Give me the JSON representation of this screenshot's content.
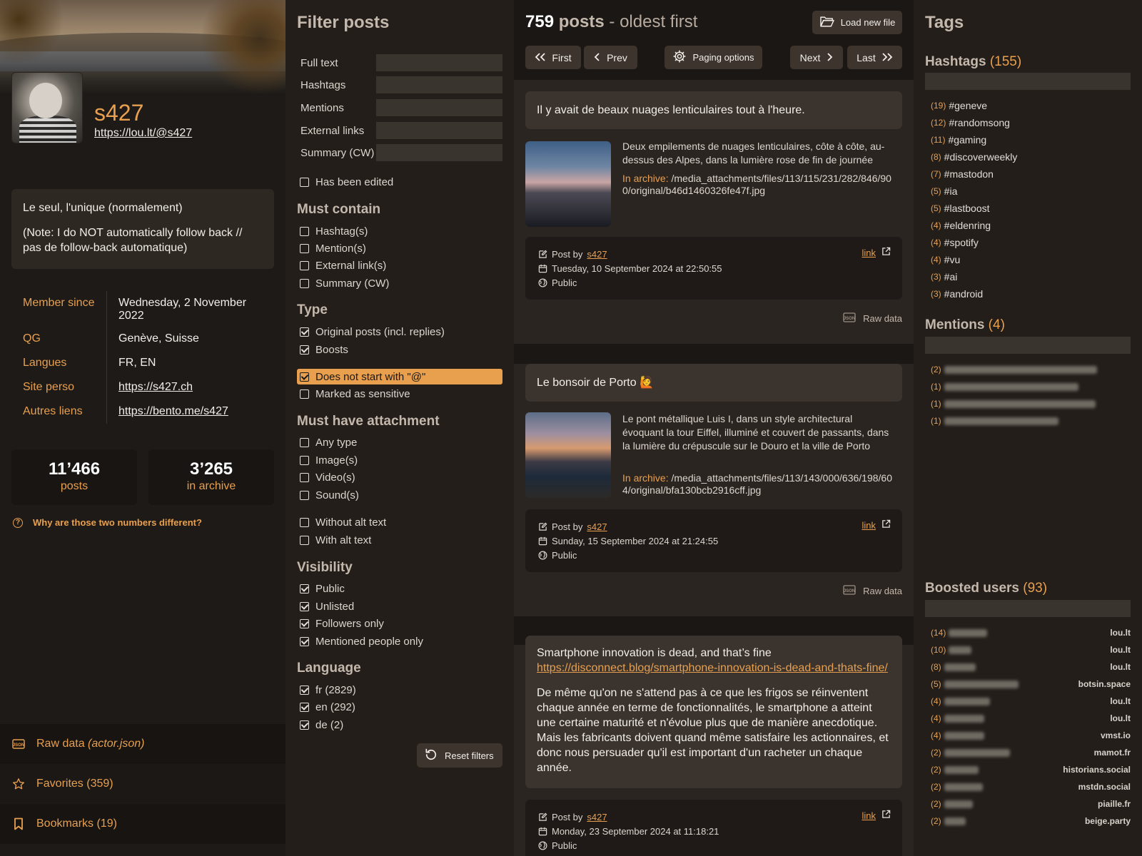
{
  "profile": {
    "username": "s427",
    "profile_url": "https://lou.lt/@s427",
    "bio": [
      "Le seul, l'unique (normalement)",
      "(Note: I do NOT automatically follow back // pas de follow-back automatique)"
    ],
    "fields": [
      {
        "key": "Member since",
        "value": "Wednesday, 2 November 2022",
        "link": false
      },
      {
        "key": "QG",
        "value": "Genève, Suisse",
        "link": false
      },
      {
        "key": "Langues",
        "value": "FR, EN",
        "link": false
      },
      {
        "key": "Site perso",
        "value": "https://s427.ch",
        "link": true
      },
      {
        "key": "Autres liens",
        "value": "https://bento.me/s427",
        "link": true
      }
    ],
    "stats": {
      "posts_num": "11’466",
      "posts_label": "posts",
      "archive_num": "3’265",
      "archive_label": "in archive"
    },
    "why_text": "Why are those two numbers different?",
    "nav": {
      "raw_label": "Raw data",
      "raw_file": "(actor.json)",
      "favorites": "Favorites (359)",
      "bookmarks": "Bookmarks (19)"
    }
  },
  "filters": {
    "title": "Filter posts",
    "text_fields": [
      "Full text",
      "Hashtags",
      "Mentions",
      "External links",
      "Summary (CW)"
    ],
    "has_been_edited": "Has been edited",
    "must_contain_title": "Must contain",
    "must_contain": [
      "Hashtag(s)",
      "Mention(s)",
      "External link(s)",
      "Summary (CW)"
    ],
    "type_title": "Type",
    "type_original": "Original posts (incl. replies)",
    "type_boosts": "Boosts",
    "no_at": "Does not start with \"@\"",
    "sensitive": "Marked as sensitive",
    "attachment_title": "Must have attachment",
    "attachment": [
      "Any type",
      "Image(s)",
      "Video(s)",
      "Sound(s)"
    ],
    "without_alt": "Without alt text",
    "with_alt": "With alt text",
    "visibility_title": "Visibility",
    "visibility": [
      "Public",
      "Unlisted",
      "Followers only",
      "Mentioned people only"
    ],
    "language_title": "Language",
    "languages": [
      "fr (2829)",
      "en (292)",
      "de (2)"
    ],
    "reset": "Reset filters"
  },
  "posts_header": {
    "count": "759",
    "label": "posts",
    "sort": "- oldest first",
    "load_new_file": "Load new file",
    "first": "First",
    "prev": "Prev",
    "paging_options": "Paging options",
    "next": "Next",
    "last": "Last"
  },
  "posts": [
    {
      "text": "Il y avait de beaux nuages lenticulaires tout à l'heure.",
      "attachment_desc": "Deux empilements de nuages lenticulaires, côte à côte, au-dessus des Alpes, dans la lumière rose de fin de journée",
      "archive_label": "In archive:",
      "archive_path": "/media_attachments/files/113/115/231/282/846/900/original/b46d1460326fe47f.jpg",
      "post_by": "Post by",
      "author": "s427",
      "date": "Tuesday, 10 September 2024 at 22:50:55",
      "visibility": "Public",
      "link": "link",
      "raw": "Raw data"
    },
    {
      "text": "Le bonsoir de Porto 🙋",
      "attachment_desc": "Le pont métallique Luis I, dans un style architectural évoquant la tour Eiffel, illuminé et couvert de passants, dans la lumière du crépuscule sur le Douro et la ville de Porto",
      "archive_label": "In archive:",
      "archive_path": "/media_attachments/files/113/143/000/636/198/604/original/bfa130bcb2916cff.jpg",
      "post_by": "Post by",
      "author": "s427",
      "date": "Sunday, 15 September 2024 at 21:24:55",
      "visibility": "Public",
      "link": "link",
      "raw": "Raw data"
    },
    {
      "text": "Smartphone innovation is dead, and that’s fine",
      "url": "https://disconnect.blog/smartphone-innovation-is-dead-and-thats-fine/",
      "body": "De même qu'on ne s'attend pas à ce que les frigos se réinventent chaque année en terme de fonctionnalités, le smartphone a atteint une certaine maturité et n'évolue plus que de manière anecdotique. Mais les fabricants doivent quand même satisfaire les actionnaires, et donc nous persuader qu'il est important d'un racheter un chaque année.",
      "post_by": "Post by",
      "author": "s427",
      "date": "Monday, 23 September 2024 at 11:18:21",
      "visibility": "Public",
      "link": "link"
    }
  ],
  "tags": {
    "title": "Tags",
    "hashtags_title": "Hashtags",
    "hashtags_count": "(155)",
    "hashtags": [
      {
        "n": "(19)",
        "tag": "#geneve"
      },
      {
        "n": "(12)",
        "tag": "#randomsong"
      },
      {
        "n": "(11)",
        "tag": "#gaming"
      },
      {
        "n": "(8)",
        "tag": "#discoverweekly"
      },
      {
        "n": "(7)",
        "tag": "#mastodon"
      },
      {
        "n": "(5)",
        "tag": "#ia"
      },
      {
        "n": "(5)",
        "tag": "#lastboost"
      },
      {
        "n": "(4)",
        "tag": "#eldenring"
      },
      {
        "n": "(4)",
        "tag": "#spotify"
      },
      {
        "n": "(4)",
        "tag": "#vu"
      },
      {
        "n": "(3)",
        "tag": "#ai"
      },
      {
        "n": "(3)",
        "tag": "#android"
      }
    ],
    "mentions_title": "Mentions",
    "mentions_count": "(4)",
    "mentions": [
      "(2)",
      "(1)",
      "(1)",
      "(1)"
    ],
    "boosted_title": "Boosted users",
    "boosted_count": "(93)",
    "boosted": [
      {
        "n": "(14)",
        "inst": "lou.lt"
      },
      {
        "n": "(10)",
        "inst": "lou.lt"
      },
      {
        "n": "(8)",
        "inst": "lou.lt"
      },
      {
        "n": "(5)",
        "inst": "botsin.space"
      },
      {
        "n": "(4)",
        "inst": "lou.lt"
      },
      {
        "n": "(4)",
        "inst": "lou.lt"
      },
      {
        "n": "(4)",
        "inst": "vmst.io"
      },
      {
        "n": "(2)",
        "inst": "mamot.fr"
      },
      {
        "n": "(2)",
        "inst": "historians.social"
      },
      {
        "n": "(2)",
        "inst": "mstdn.social"
      },
      {
        "n": "(2)",
        "inst": "piaille.fr"
      },
      {
        "n": "(2)",
        "inst": "beige.party"
      }
    ]
  },
  "colors": {
    "accent": "#e8a050",
    "background": "#1b1714",
    "panel": "#231e1a"
  }
}
